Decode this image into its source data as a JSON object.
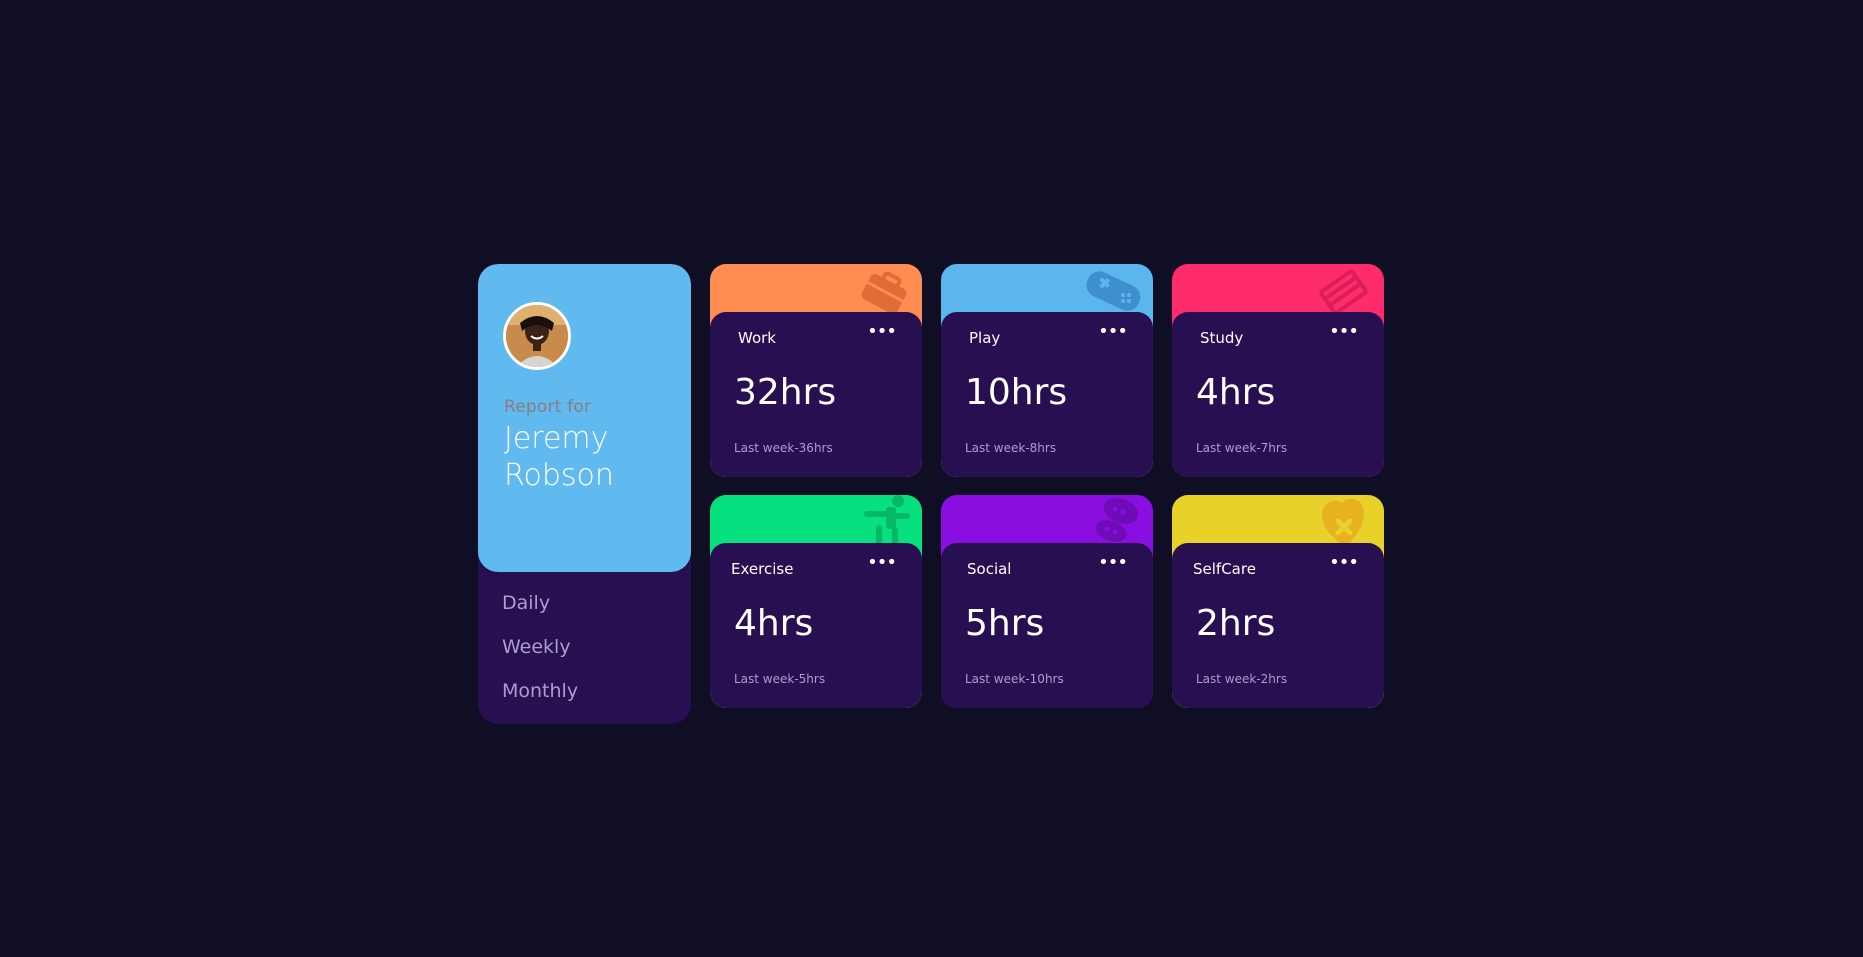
{
  "profile": {
    "report_label": "Report for",
    "name_line1": "Jeremy",
    "name_line2": "Robson",
    "periods": [
      "Daily",
      "Weekly",
      "Monthly"
    ]
  },
  "cards": [
    {
      "title": "Work",
      "hours": "32hrs",
      "last": "Last week-36hrs",
      "color": "#ff8c50",
      "icon": "briefcase-icon"
    },
    {
      "title": "Play",
      "hours": "10hrs",
      "last": "Last week-8hrs",
      "color": "#5ab6ec",
      "icon": "gamepad-icon"
    },
    {
      "title": "Study",
      "hours": "4hrs",
      "last": "Last week-7hrs",
      "color": "#ff2c6b",
      "icon": "books-icon"
    },
    {
      "title": "Exercise",
      "hours": "4hrs",
      "last": "Last week-5hrs",
      "color": "#07e07f",
      "icon": "runner-icon"
    },
    {
      "title": "Social",
      "hours": "5hrs",
      "last": "Last week-10hrs",
      "color": "#8b0ee0",
      "icon": "speech-icon"
    },
    {
      "title": "SelfCare",
      "hours": "2hrs",
      "last": "Last week-2hrs",
      "color": "#e8d22a",
      "icon": "heart-icon"
    }
  ],
  "more_glyph": "•••"
}
